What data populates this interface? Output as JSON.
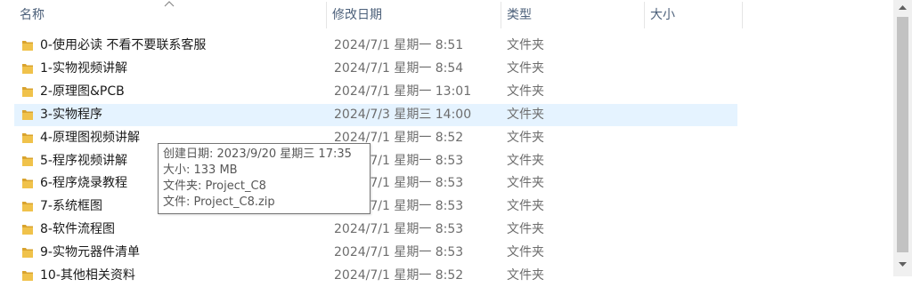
{
  "header": {
    "name": "名称",
    "date": "修改日期",
    "type": "类型",
    "size": "大小"
  },
  "rows": [
    {
      "name": "0-使用必读  不看不要联系客服",
      "date": "2024/7/1 星期一 8:51",
      "type": "文件夹"
    },
    {
      "name": "1-实物视频讲解",
      "date": "2024/7/1 星期一 8:54",
      "type": "文件夹"
    },
    {
      "name": "2-原理图&PCB",
      "date": "2024/7/1 星期一 13:01",
      "type": "文件夹"
    },
    {
      "name": "3-实物程序",
      "date": "2024/7/3 星期三 14:00",
      "type": "文件夹"
    },
    {
      "name": "4-原理图视频讲解",
      "date": "2024/7/1 星期一 8:52",
      "type": "文件夹"
    },
    {
      "name": "5-程序视频讲解",
      "date": "2024/7/1 星期一 8:53",
      "type": "文件夹"
    },
    {
      "name": "6-程序烧录教程",
      "date": "2024/7/1 星期一 8:53",
      "type": "文件夹"
    },
    {
      "name": "7-系统框图",
      "date": "2024/7/1 星期一 8:53",
      "type": "文件夹"
    },
    {
      "name": "8-软件流程图",
      "date": "2024/7/1 星期一 8:53",
      "type": "文件夹"
    },
    {
      "name": "9-实物元器件清单",
      "date": "2024/7/1 星期一 8:53",
      "type": "文件夹"
    },
    {
      "name": "10-其他相关资料",
      "date": "2024/7/1 星期一 8:52",
      "type": "文件夹"
    }
  ],
  "selected_index": 3,
  "tooltip": {
    "line1": "创建日期: 2023/9/20 星期三 17:35",
    "line2": "大小: 133 MB",
    "line3": "文件夹: Project_C8",
    "line4": "文件: Project_C8.zip"
  },
  "colors": {
    "folder": "#f0c24b",
    "selection": "#e5f3ff",
    "header_text": "#4c607a"
  },
  "icons": {
    "sort": "chevron-up-icon",
    "folder": "folder-icon",
    "scroll_up": "arrow-up-icon",
    "scroll_down": "arrow-down-icon"
  }
}
